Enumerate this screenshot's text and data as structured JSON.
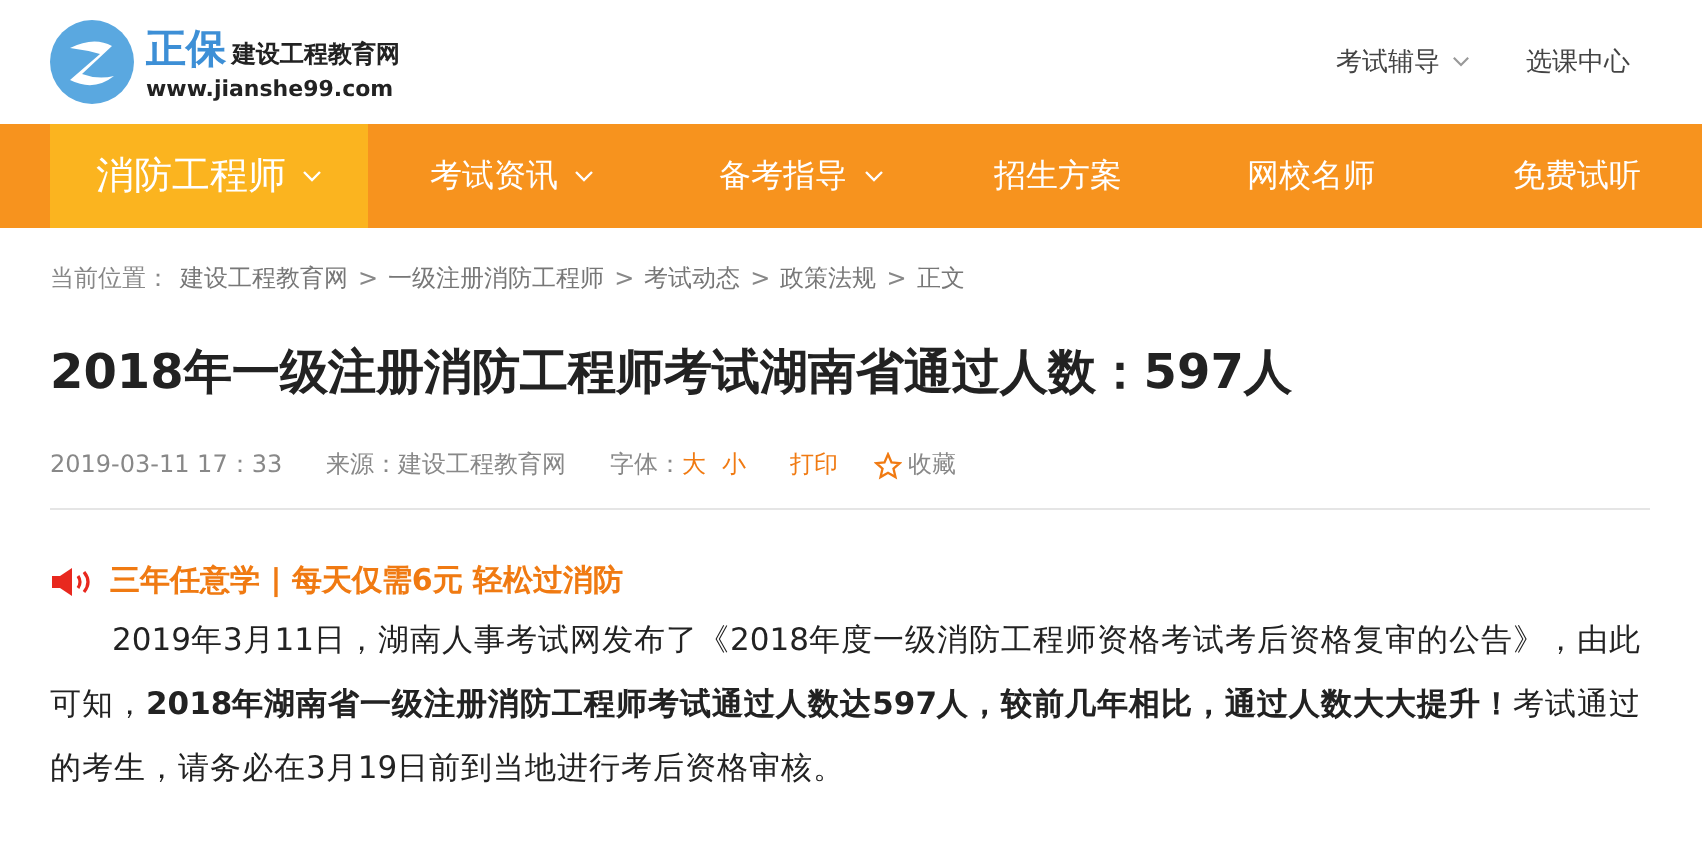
{
  "logo": {
    "brand": "正保",
    "site": "建设工程教育网",
    "url": "www.jianshe99.com"
  },
  "top_links": [
    {
      "label": "考试辅导",
      "dropdown": true
    },
    {
      "label": "选课中心",
      "dropdown": false
    }
  ],
  "nav": [
    {
      "label": "消防工程师",
      "dropdown": true,
      "selected": true
    },
    {
      "label": "考试资讯",
      "dropdown": true,
      "selected": false
    },
    {
      "label": "备考指导",
      "dropdown": true,
      "selected": false
    },
    {
      "label": "招生方案",
      "dropdown": false,
      "selected": false
    },
    {
      "label": "网校名师",
      "dropdown": false,
      "selected": false
    },
    {
      "label": "免费试听",
      "dropdown": false,
      "selected": false
    }
  ],
  "breadcrumb": {
    "prefix": "当前位置：",
    "items": [
      "建设工程教育网",
      "一级注册消防工程师",
      "考试动态",
      "政策法规",
      "正文"
    ],
    "separator": ">"
  },
  "article": {
    "title": "2018年一级注册消防工程师考试湖南省通过人数：597人",
    "meta": {
      "datetime": "2019-03-11 17：33",
      "source": "来源：建设工程教育网",
      "font_label": "字体：",
      "font_large": "大",
      "font_small": "小",
      "print": "打印",
      "favorite": "收藏"
    },
    "promo": "三年任意学 | 每天仅需6元 轻松过消防",
    "paragraph": "2019年3月11日，湖南人事考试网发布了《2018年度一级消防工程师资格考试考后资格复审的公告》，由此可知，**2018年湖南省一级注册消防工程师考试通过人数达597人，较前几年相比，通过人数大大提升！**考试通过的考生，请务必在3月19日前到当地进行考后资格审核。"
  }
}
